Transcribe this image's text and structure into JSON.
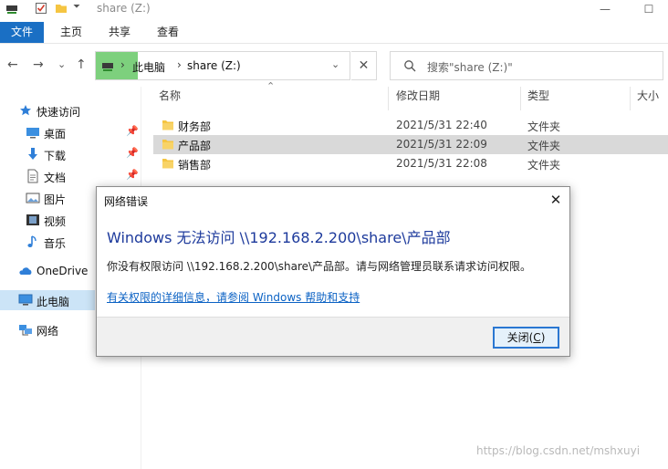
{
  "window": {
    "title": "share (Z:)",
    "minimize_glyph": "—",
    "maximize_glyph": "☐"
  },
  "ribbon": {
    "tabs": [
      "文件",
      "主页",
      "共享",
      "查看"
    ]
  },
  "nav": {
    "back_glyph": "←",
    "forward_glyph": "→",
    "recent_glyph": "⌄",
    "up_glyph": "↑",
    "address_crumbs": [
      "此电脑",
      "share (Z:)"
    ],
    "crumb_separator": "›",
    "address_dropdown_glyph": "⌄",
    "refresh_glyph": "✕",
    "search_placeholder": "搜索\"share (Z:)\""
  },
  "sidebar": {
    "quick_access": "快速访问",
    "quick_items": [
      {
        "label": "桌面",
        "icon": "desktop-icon"
      },
      {
        "label": "下载",
        "icon": "download-icon"
      },
      {
        "label": "文档",
        "icon": "document-icon"
      },
      {
        "label": "图片",
        "icon": "pictures-icon"
      },
      {
        "label": "视频",
        "icon": "video-icon"
      },
      {
        "label": "音乐",
        "icon": "music-icon"
      }
    ],
    "pin_glyph": "📌",
    "onedrive": "OneDrive",
    "this_pc": "此电脑",
    "network": "网络"
  },
  "columns": {
    "name": "名称",
    "modified": "修改日期",
    "type": "类型",
    "size": "大小",
    "sort_glyph": "⌃"
  },
  "files": [
    {
      "name": "财务部",
      "modified": "2021/5/31 22:40",
      "type": "文件夹"
    },
    {
      "name": "产品部",
      "modified": "2021/5/31 22:09",
      "type": "文件夹"
    },
    {
      "name": "销售部",
      "modified": "2021/5/31 22:08",
      "type": "文件夹"
    }
  ],
  "dialog": {
    "title": "网络错误",
    "close_glyph": "✕",
    "heading": "Windows 无法访问 \\\\192.168.2.200\\share\\产品部",
    "message": "你没有权限访问 \\\\192.168.2.200\\share\\产品部。请与网络管理员联系请求访问权限。",
    "link": "有关权限的详细信息，请参阅 Windows 帮助和支持",
    "button_label": "关闭(",
    "button_accel": "C",
    "button_label_end": ")"
  },
  "watermark": "https://blog.csdn.net/mshxuyi",
  "colors": {
    "accent": "#1a6fc4",
    "address_highlight": "#7dd07d",
    "selected_row": "#d9d9d9",
    "heading_blue": "#1d3a9c",
    "link_blue": "#0b62c4"
  }
}
